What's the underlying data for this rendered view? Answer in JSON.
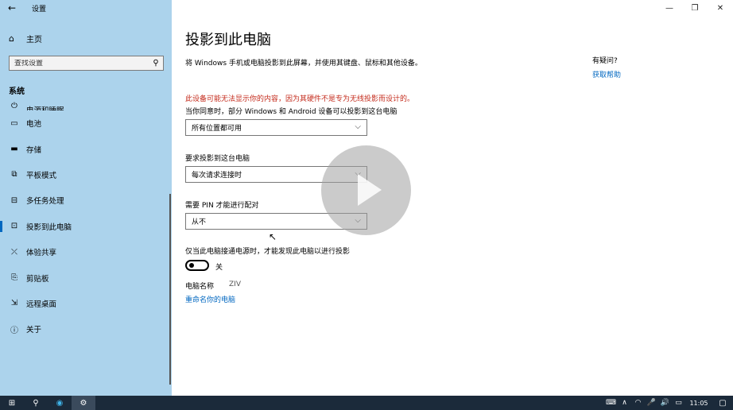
{
  "window": {
    "app_title": "设置",
    "back_icon": "←",
    "minimize_icon": "—",
    "restore_icon": "❐",
    "close_icon": "✕"
  },
  "sidebar": {
    "home_label": "主页",
    "home_icon": "⌂",
    "search_placeholder": "查找设置",
    "search_icon": "⚲",
    "section_title": "系统",
    "clipped_item": "电源和睡眠",
    "items": [
      {
        "label": "电池",
        "icon": "▭",
        "active": false
      },
      {
        "label": "存储",
        "icon": "▬",
        "active": false
      },
      {
        "label": "平板模式",
        "icon": "⧉",
        "active": false
      },
      {
        "label": "多任务处理",
        "icon": "⊟",
        "active": false
      },
      {
        "label": "投影到此电脑",
        "icon": "⊡",
        "active": true
      },
      {
        "label": "体验共享",
        "icon": "⤫",
        "active": false
      },
      {
        "label": "剪贴板",
        "icon": "⎘",
        "active": false
      },
      {
        "label": "远程桌面",
        "icon": "⇲",
        "active": false
      },
      {
        "label": "关于",
        "icon": "ⓘ",
        "active": false
      }
    ]
  },
  "main": {
    "title": "投影到此电脑",
    "description": "将 Windows 手机或电脑投影到此屏幕，并使用其键盘、鼠标和其他设备。",
    "warning": "此设备可能无法显示你的内容，因为其硬件不是专为无线投影而设计的。",
    "setting1": {
      "label": "当你同意时，部分 Windows 和 Android 设备可以投影到这台电脑",
      "value": "所有位置都可用"
    },
    "setting2": {
      "label": "要求投影到这台电脑",
      "value": "每次请求连接时"
    },
    "setting3": {
      "label": "需要 PIN 才能进行配对",
      "value": "从不"
    },
    "setting4": {
      "label": "仅当此电脑接通电源时，才能发现此电脑以进行投影",
      "toggle_state": "关"
    },
    "pc_name_label": "电脑名称",
    "pc_name_value": "ZIV",
    "rename_link": "重命名你的电脑",
    "chevron_icon": "⌵",
    "help_title": "有疑问?",
    "help_link": "获取帮助"
  },
  "taskbar": {
    "start_icon": "⊞",
    "search_icon": "⚲",
    "edge_icon": "◉",
    "settings_icon": "⚙",
    "tray_icons": [
      "⌨",
      "∧",
      "◠",
      "🎤",
      "🔊",
      "▭"
    ],
    "clock": "11:05",
    "notification_icon": "▢"
  }
}
